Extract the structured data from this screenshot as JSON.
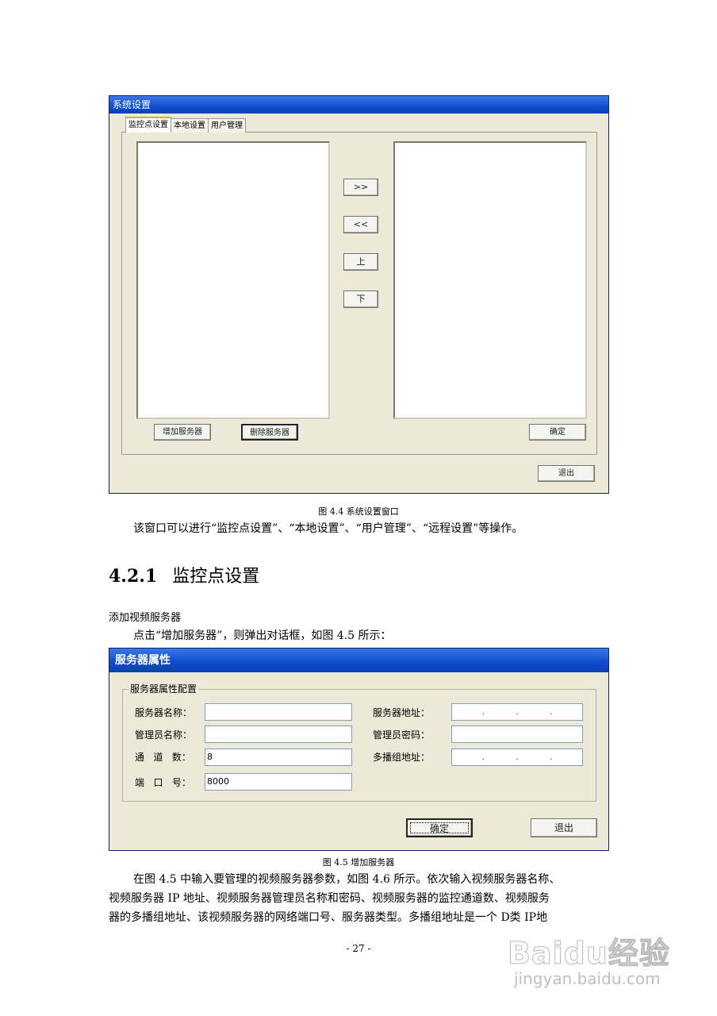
{
  "window1": {
    "title": "系统设置",
    "tabs": [
      "监控点设置",
      "本地设置",
      "用户管理"
    ],
    "move_right": ">>",
    "move_left": "<<",
    "move_up": "上",
    "move_down": "下",
    "add_server": "增加服务器",
    "delete_server": "删除服务器",
    "confirm": "确定",
    "exit": "退出"
  },
  "caption1": "图 4.4  系统设置窗口",
  "para1": "该窗口可以进行“监控点设置”、“本地设置”、“用户管理”、“远程设置”等操作。",
  "heading": {
    "number": "4.2.1",
    "text": "监控点设置"
  },
  "subhead": "添加视频服务器",
  "para2": "点击“增加服务器”，则弹出对话框，如图 4.5 所示：",
  "window2": {
    "title": "服务器属性",
    "group": "服务器属性配置",
    "labels": {
      "server_name": "服务器名称：",
      "admin_name": "管理员名称：",
      "channels": "通   道   数：",
      "port": "端   口   号：",
      "server_addr": "服务器地址：",
      "admin_pwd": "管理员密码：",
      "multicast": "多播组地址："
    },
    "values": {
      "server_name": "",
      "admin_name": "",
      "channels": "8",
      "port": "8000",
      "admin_pwd": ""
    },
    "ip_dot": ".",
    "confirm": "确定",
    "exit": "退出"
  },
  "caption2": "图 4.5 增加服务器",
  "para3_lines": [
    "在图 4.5 中输入要管理的视频服务器参数，如图 4.6 所示。依次输入视频服务器名称、",
    "视频服务器 IP 地址、视频服务器管理员名称和密码、视频服务器的监控通道数、视频服务",
    "器的多播组地址、该视频服务器的网络端口号、服务器类型。多播组地址是一个 D类 IP地"
  ],
  "page_number": "- 27 -",
  "watermark": {
    "logo": "Baidu经验",
    "url": "jingyan.baidu.com"
  }
}
